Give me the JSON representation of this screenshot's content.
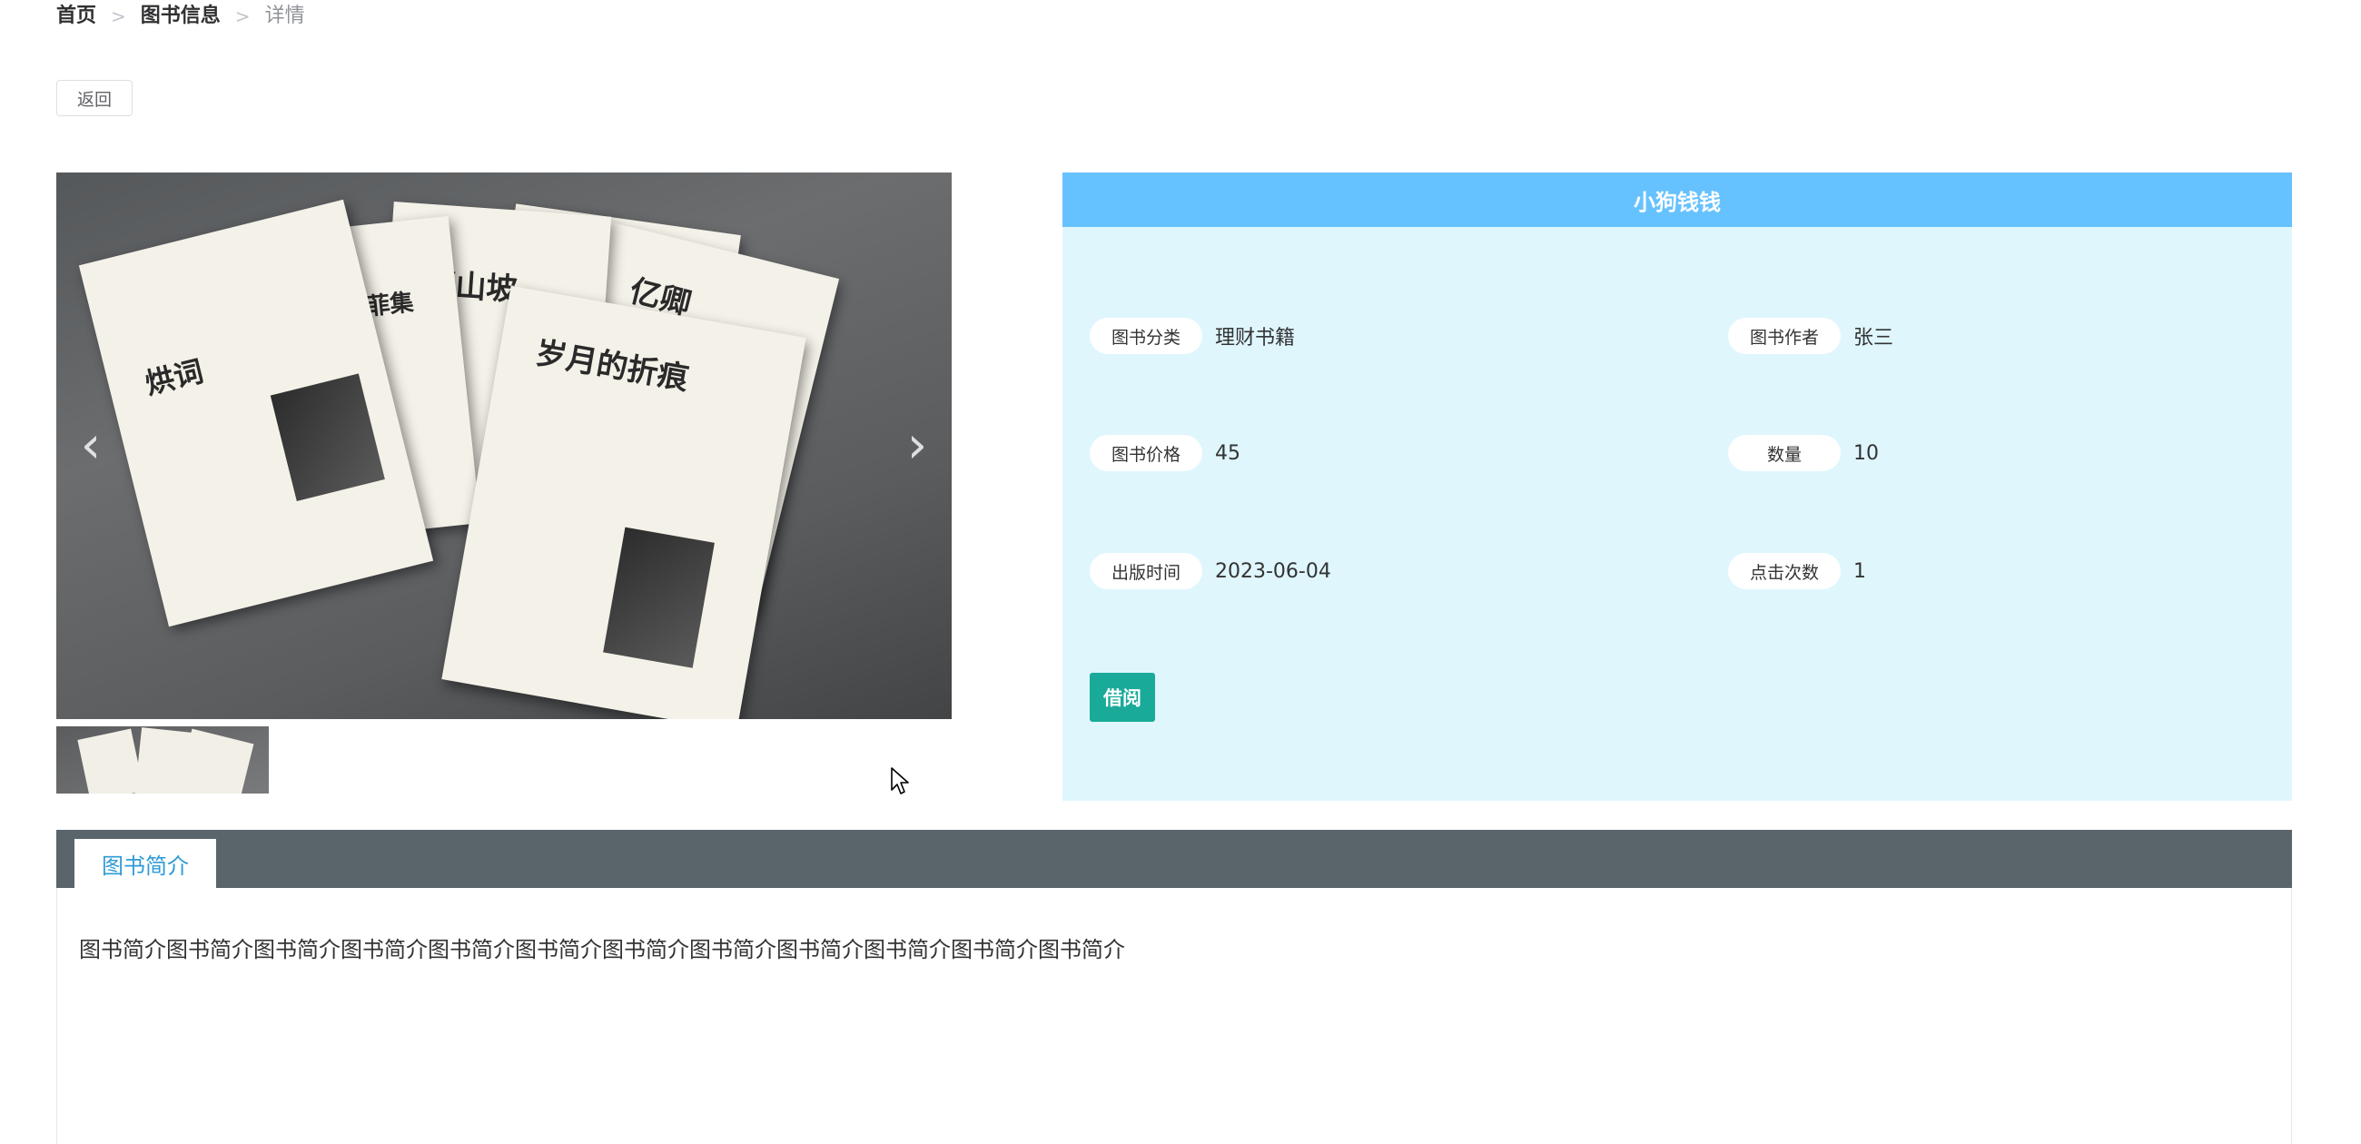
{
  "breadcrumb": {
    "home": "首页",
    "section": "图书信息",
    "current": "详情",
    "separator": ">"
  },
  "back_button": "返回",
  "gallery": {
    "prev_icon": "chevron-left-icon",
    "next_icon": "chevron-right-icon",
    "book_titles": [
      "烘词",
      "菲集",
      "野山坡",
      "亿卿",
      "岁月的折痕"
    ]
  },
  "info": {
    "title": "小狗钱钱",
    "fields": [
      {
        "label": "图书分类",
        "value": "理财书籍"
      },
      {
        "label": "图书作者",
        "value": "张三"
      },
      {
        "label": "图书价格",
        "value": "45"
      },
      {
        "label": "数量",
        "value": "10"
      },
      {
        "label": "出版时间",
        "value": "2023-06-04"
      },
      {
        "label": "点击次数",
        "value": "1"
      }
    ],
    "borrow_button": "借阅"
  },
  "tabs": {
    "active": "图书简介"
  },
  "intro": {
    "text": "图书简介图书简介图书简介图书简介图书简介图书简介图书简介图书简介图书简介图书简介图书简介图书简介"
  },
  "colors": {
    "panel_bg": "#dff6fd",
    "panel_header": "#66c2ff",
    "borrow_button": "#1aaa9a",
    "tab_bar": "#5a646b",
    "tab_active_text": "#2e9bd6"
  }
}
